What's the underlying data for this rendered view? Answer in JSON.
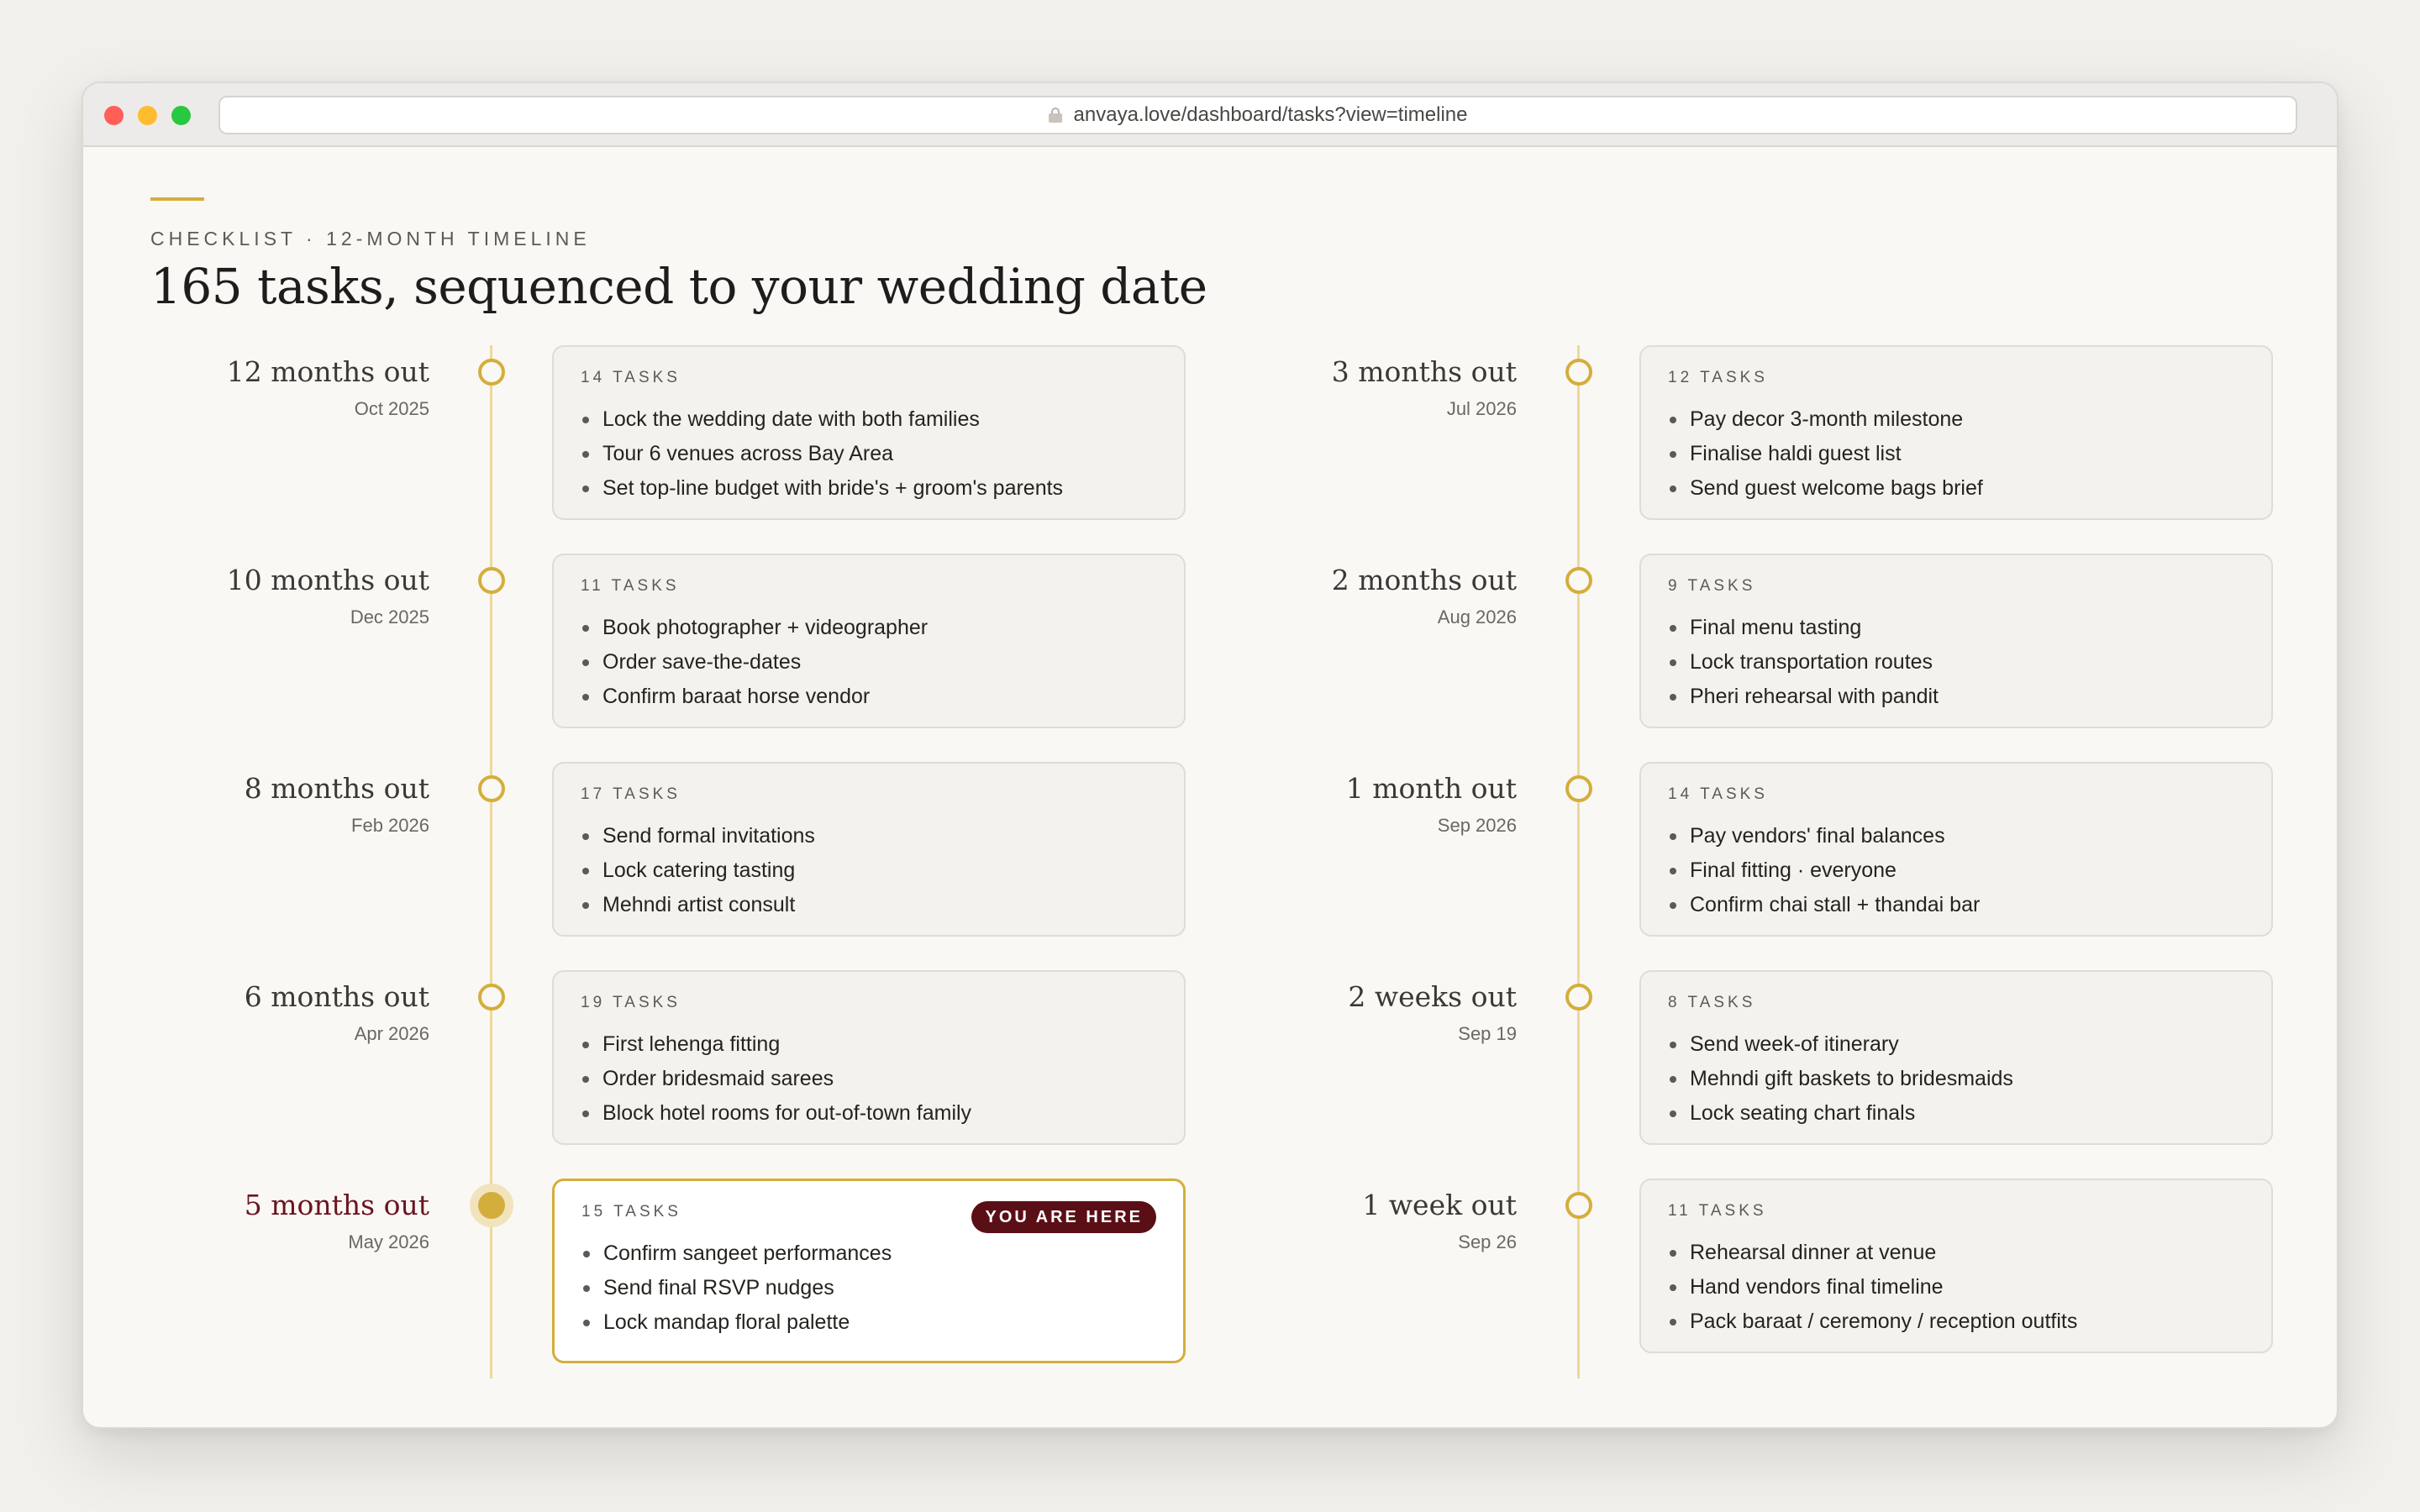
{
  "browser": {
    "url": "anvaya.love/dashboard/tasks?view=timeline"
  },
  "header": {
    "eyebrow": "CHECKLIST · 12-MONTH TIMELINE",
    "title": "165 tasks, sequenced to your wedding date"
  },
  "colors": {
    "accent_gold": "#d4ae3c",
    "current_maroon": "#5a0f16",
    "rail": "#ecd99a"
  },
  "timeline": {
    "left": [
      {
        "label": "12 months out",
        "date": "Oct 2025",
        "count": "14 TASKS",
        "tasks": [
          "Lock the wedding date with both families",
          "Tour 6 venues across Bay Area",
          "Set top-line budget with bride's + groom's parents"
        ]
      },
      {
        "label": "10 months out",
        "date": "Dec 2025",
        "count": "11 TASKS",
        "tasks": [
          "Book photographer + videographer",
          "Order save-the-dates",
          "Confirm baraat horse vendor"
        ]
      },
      {
        "label": "8 months out",
        "date": "Feb 2026",
        "count": "17 TASKS",
        "tasks": [
          "Send formal invitations",
          "Lock catering tasting",
          "Mehndi artist consult"
        ]
      },
      {
        "label": "6 months out",
        "date": "Apr 2026",
        "count": "19 TASKS",
        "tasks": [
          "First lehenga fitting",
          "Order bridesmaid sarees",
          "Block hotel rooms for out-of-town family"
        ]
      },
      {
        "label": "5 months out",
        "date": "May 2026",
        "count": "15 TASKS",
        "badge": "YOU ARE HERE",
        "tasks": [
          "Confirm sangeet performances",
          "Send final RSVP nudges",
          "Lock mandap floral palette"
        ]
      }
    ],
    "right": [
      {
        "label": "3 months out",
        "date": "Jul 2026",
        "count": "12 TASKS",
        "tasks": [
          "Pay decor 3-month milestone",
          "Finalise haldi guest list",
          "Send guest welcome bags brief"
        ]
      },
      {
        "label": "2 months out",
        "date": "Aug 2026",
        "count": "9 TASKS",
        "tasks": [
          "Final menu tasting",
          "Lock transportation routes",
          "Pheri rehearsal with pandit"
        ]
      },
      {
        "label": "1 month out",
        "date": "Sep 2026",
        "count": "14 TASKS",
        "tasks": [
          "Pay vendors' final balances",
          "Final fitting · everyone",
          "Confirm chai stall + thandai bar"
        ]
      },
      {
        "label": "2 weeks out",
        "date": "Sep 19",
        "count": "8 TASKS",
        "tasks": [
          "Send week-of itinerary",
          "Mehndi gift baskets to bridesmaids",
          "Lock seating chart finals"
        ]
      },
      {
        "label": "1 week out",
        "date": "Sep 26",
        "count": "11 TASKS",
        "tasks": [
          "Rehearsal dinner at venue",
          "Hand vendors final timeline",
          "Pack baraat / ceremony / reception outfits"
        ]
      }
    ]
  }
}
